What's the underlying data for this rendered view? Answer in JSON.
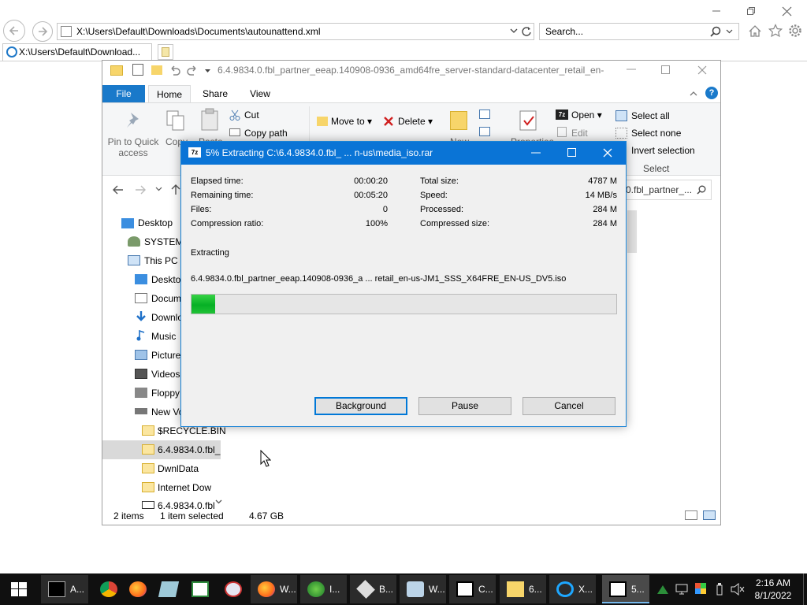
{
  "browser": {
    "address": "X:\\Users\\Default\\Downloads\\Documents\\autounattend.xml",
    "search_placeholder": "Search...",
    "tab_title": "X:\\Users\\Default\\Download..."
  },
  "explorer": {
    "title": "6.4.9834.0.fbl_partner_eeap.140908-0936_amd64fre_server-standard-datacenter_retail_en-us",
    "tabs": [
      "File",
      "Home",
      "Share",
      "View"
    ],
    "ribbon": {
      "pin": "Pin to Quick access",
      "pin_l1": "Pin to Quick",
      "pin_l2": "access",
      "copy": "Copy",
      "paste": "Paste",
      "cut": "Cut",
      "copy_path": "Copy path",
      "move_to": "Move to",
      "delete": "Delete",
      "new": "New",
      "properties": "Properties",
      "open": "Open",
      "edit": "Edit",
      "select_all": "Select all",
      "select_none": "Select none",
      "invert_selection": "Invert selection",
      "select_group": "Select"
    },
    "address_tail": "0.fbl_partner_...",
    "nav": [
      "Desktop",
      "SYSTEM",
      "This PC",
      "Desktop",
      "Documents",
      "Downloads",
      "Music",
      "Pictures",
      "Videos",
      "Floppy",
      "New Vo",
      "$RECYCLE.BIN",
      "6.4.9834.0.fbl_",
      "DwnlData",
      "Internet Dow",
      "6.4.9834.0.fbl"
    ],
    "status": {
      "items": "2 items",
      "selected": "1 item selected",
      "size": "4.67 GB"
    }
  },
  "dialog": {
    "title": "5% Extracting C:\\6.4.9834.0.fbl_ ... n-us\\media_iso.rar",
    "progress_fraction": 0.055,
    "stats_left": [
      {
        "label": "Elapsed time:",
        "value": "00:00:20"
      },
      {
        "label": "Remaining time:",
        "value": "00:05:20"
      },
      {
        "label": "Files:",
        "value": "0"
      },
      {
        "label": "Compression ratio:",
        "value": "100%"
      }
    ],
    "stats_right": [
      {
        "label": "Total size:",
        "value": "4787 M"
      },
      {
        "label": "Speed:",
        "value": "14 MB/s"
      },
      {
        "label": "Processed:",
        "value": "284 M"
      },
      {
        "label": "Compressed size:",
        "value": "284 M"
      }
    ],
    "status_label": "Extracting",
    "current_file": "6.4.9834.0.fbl_partner_eeap.140908-0936_a ... retail_en-us-JM1_SSS_X64FRE_EN-US_DV5.iso",
    "buttons": {
      "background": "Background",
      "pause": "Pause",
      "cancel": "Cancel"
    }
  },
  "taskbar": {
    "items": [
      {
        "label": "A...",
        "icon": "terminal-icon"
      },
      {
        "label": "",
        "icon": "chrome-icon"
      },
      {
        "label": "",
        "icon": "firefox-icon"
      },
      {
        "label": "",
        "icon": "app-icon"
      },
      {
        "label": "",
        "icon": "notepad-icon"
      },
      {
        "label": "",
        "icon": "paint-icon"
      },
      {
        "label": "W...",
        "icon": "firefox-icon"
      },
      {
        "label": "I...",
        "icon": "globe-icon"
      },
      {
        "label": "B...",
        "icon": "box-icon"
      },
      {
        "label": "W...",
        "icon": "jar-icon"
      },
      {
        "label": "C...",
        "icon": "7zip-icon"
      },
      {
        "label": "6...",
        "icon": "folder-icon"
      },
      {
        "label": "X...",
        "icon": "ie-icon"
      },
      {
        "label": "5...",
        "icon": "7zip-icon"
      }
    ],
    "time": "2:16 AM",
    "date": "8/1/2022"
  }
}
